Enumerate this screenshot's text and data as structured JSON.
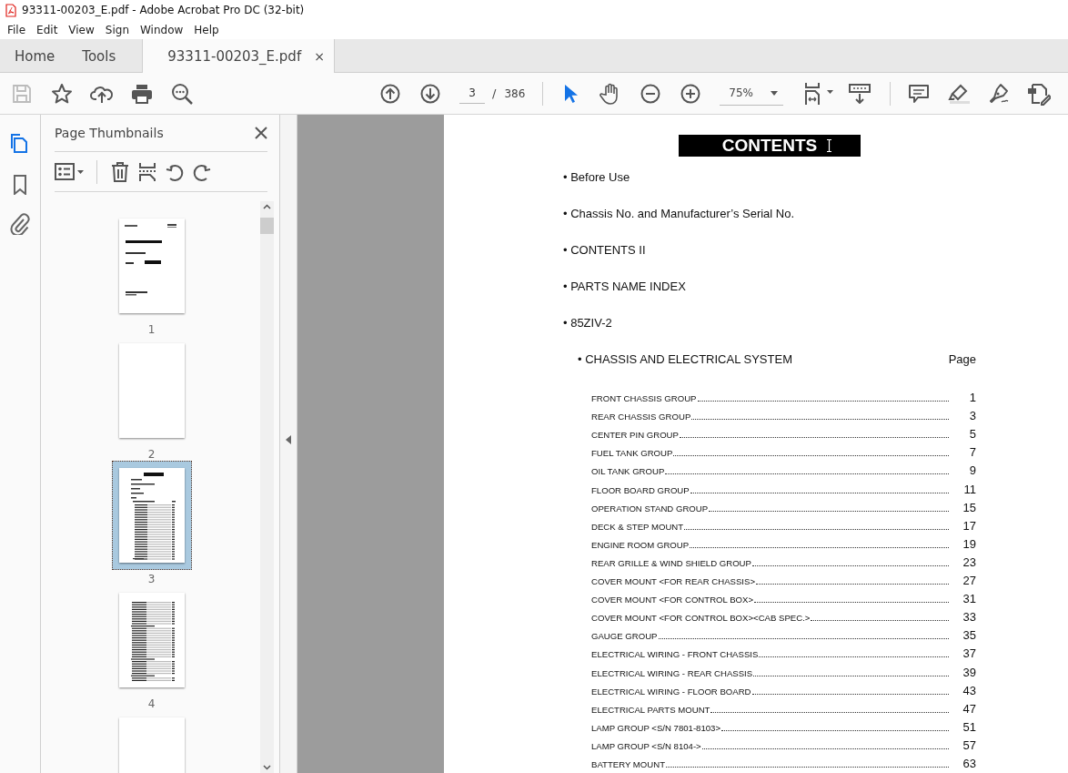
{
  "window": {
    "title": "93311-00203_E.pdf - Adobe Acrobat Pro DC (32-bit)"
  },
  "menu": [
    "File",
    "Edit",
    "View",
    "Sign",
    "Window",
    "Help"
  ],
  "tabs": [
    {
      "label": "Home",
      "kind": "nav",
      "selected": false
    },
    {
      "label": "Tools",
      "kind": "nav",
      "selected": false
    },
    {
      "label": "93311-00203_E.pdf",
      "kind": "document",
      "selected": true,
      "close": "×"
    }
  ],
  "toolbar": {
    "save_disabled": true,
    "page_current": "3",
    "page_separator": "/",
    "page_total": "386",
    "zoom": "75%",
    "tools": [
      {
        "kind": "select",
        "selected": true
      },
      {
        "kind": "hand",
        "selected": false
      }
    ]
  },
  "side_rail": [
    {
      "kind": "pages",
      "selected": true
    },
    {
      "kind": "bookmarks",
      "selected": false
    },
    {
      "kind": "attachments",
      "selected": false
    }
  ],
  "thumbnails_panel": {
    "title": "Page Thumbnails",
    "thumbnails": [
      {
        "label": "1",
        "kind": "cover",
        "selected": false
      },
      {
        "label": "2",
        "kind": "blank",
        "selected": false
      },
      {
        "label": "3",
        "kind": "contents",
        "selected": true
      },
      {
        "label": "4",
        "kind": "list",
        "selected": false
      },
      {
        "kind": "blank",
        "selected": false
      }
    ]
  },
  "document": {
    "heading": "CONTENTS",
    "items": [
      "• Before Use",
      "• Chassis No. and Manufacturer’s Serial No.",
      "• CONTENTS II",
      "• PARTS NAME INDEX",
      "• 85ZIV-2"
    ],
    "section": {
      "title": "• CHASSIS AND ELECTRICAL SYSTEM",
      "page_header": "Page",
      "entries": [
        {
          "title": "FRONT CHASSIS GROUP",
          "page": "1"
        },
        {
          "title": "REAR CHASSIS GROUP",
          "page": "3"
        },
        {
          "title": "CENTER PIN GROUP",
          "page": "5"
        },
        {
          "title": "FUEL TANK GROUP",
          "page": "7"
        },
        {
          "title": "OIL TANK GROUP",
          "page": "9"
        },
        {
          "title": "FLOOR BOARD GROUP",
          "page": "11"
        },
        {
          "title": "OPERATION STAND GROUP",
          "page": "15"
        },
        {
          "title": "DECK & STEP MOUNT",
          "page": "17"
        },
        {
          "title": "ENGINE ROOM GROUP",
          "page": "19"
        },
        {
          "title": "REAR GRILLE & WIND SHIELD GROUP",
          "page": "23"
        },
        {
          "title": "COVER MOUNT <FOR REAR CHASSIS>",
          "page": "27"
        },
        {
          "title": "COVER MOUNT <FOR CONTROL BOX>",
          "page": "31"
        },
        {
          "title": "COVER MOUNT <FOR CONTROL BOX><CAB SPEC.>",
          "page": "33"
        },
        {
          "title": "GAUGE GROUP",
          "page": "35"
        },
        {
          "title": "ELECTRICAL WIRING - FRONT CHASSIS",
          "page": "37"
        },
        {
          "title": "ELECTRICAL WIRING - REAR CHASSIS",
          "page": "39"
        },
        {
          "title": "ELECTRICAL WIRING - FLOOR BOARD",
          "page": "43"
        },
        {
          "title": "ELECTRICAL PARTS MOUNT",
          "page": "47"
        },
        {
          "title": "LAMP GROUP <S/N 7801-8103>",
          "page": "51"
        },
        {
          "title": "LAMP GROUP <S/N 8104->",
          "page": "57"
        },
        {
          "title": "BATTERY MOUNT",
          "page": "63"
        }
      ]
    }
  }
}
